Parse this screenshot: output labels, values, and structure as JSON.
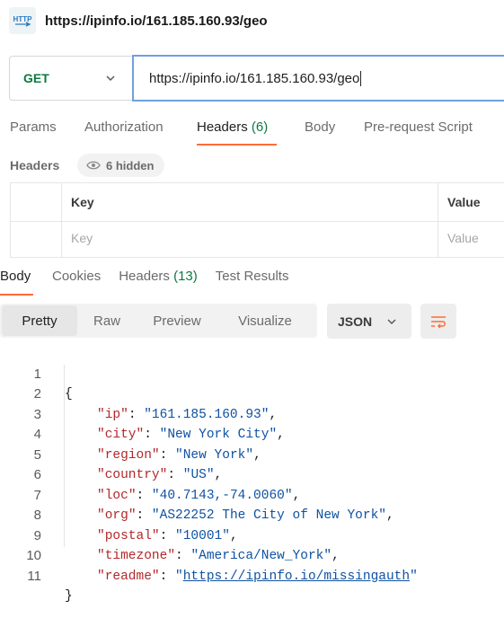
{
  "title": "https://ipinfo.io/161.185.160.93/geo",
  "icon": "http-request-icon",
  "request": {
    "method": "GET",
    "url": "https://ipinfo.io/161.185.160.93/geo"
  },
  "request_tabs": [
    {
      "label": "Params"
    },
    {
      "label": "Authorization"
    },
    {
      "label": "Headers",
      "count": "(6)"
    },
    {
      "label": "Body"
    },
    {
      "label": "Pre-request Script"
    }
  ],
  "headers_section": {
    "label": "Headers",
    "hidden": "6 hidden",
    "col_key": "Key",
    "col_value": "Value",
    "key_placeholder": "Key",
    "value_placeholder": "Value"
  },
  "response_tabs": [
    {
      "label": "Body"
    },
    {
      "label": "Cookies"
    },
    {
      "label": "Headers",
      "count": "(13)"
    },
    {
      "label": "Test Results"
    }
  ],
  "view_modes": [
    "Pretty",
    "Raw",
    "Preview",
    "Visualize"
  ],
  "format": "JSON",
  "code": {
    "open": "{",
    "close": "}",
    "fields": [
      {
        "key": "ip",
        "value": "161.185.160.93"
      },
      {
        "key": "city",
        "value": "New York City"
      },
      {
        "key": "region",
        "value": "New York"
      },
      {
        "key": "country",
        "value": "US"
      },
      {
        "key": "loc",
        "value": "40.7143,-74.0060"
      },
      {
        "key": "org",
        "value": "AS22252 The City of New York"
      },
      {
        "key": "postal",
        "value": "10001"
      },
      {
        "key": "timezone",
        "value": "America/New_York"
      },
      {
        "key": "readme",
        "value": "https://ipinfo.io/missingauth"
      }
    ],
    "line_numbers": [
      "1",
      "2",
      "3",
      "4",
      "5",
      "6",
      "7",
      "8",
      "9",
      "10",
      "11"
    ]
  },
  "colors": {
    "accent": "#ff6c37",
    "method": "#0b7a3e",
    "json_key": "#b3272a",
    "json_string": "#0f52a3",
    "focus": "#6fa0df"
  }
}
